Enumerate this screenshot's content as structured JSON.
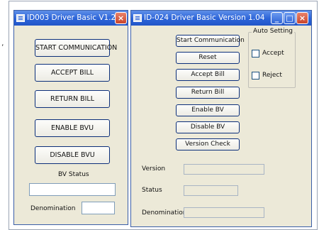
{
  "window1": {
    "title": "ID003 Driver Basic V1.2",
    "close_glyph": "×",
    "buttons": [
      "START COMMUNICATION",
      "ACCEPT BILL",
      "RETURN BILL",
      "ENABLE BVU",
      "DISABLE BVU"
    ],
    "bv_status_label": "BV Status",
    "bv_status_value": "",
    "denomination_label": "Denomination",
    "denomination_value": ""
  },
  "window2": {
    "title": "ID-024 Driver Basic Version 1.04",
    "minimize_glyph": "_",
    "maximize_glyph": "□",
    "close_glyph": "×",
    "buttons": [
      "Start Communication",
      "Reset",
      "Accept Bill",
      "Return Bill",
      "Enable BV",
      "Disable BV",
      "Version Check"
    ],
    "auto_setting": {
      "legend": "Auto Setting",
      "accept_label": "Accept",
      "accept_checked": false,
      "reject_label": "Reject",
      "reject_checked": false
    },
    "version_label": "Version",
    "version_value": "",
    "status_label": "Status",
    "status_value": "",
    "denomination_label": "Denomination",
    "denomination_value": ""
  },
  "icons": [
    "app-icon",
    "close-icon",
    "minimize-icon",
    "maximize-icon"
  ],
  "colors": {
    "titlebar": "#2b63d8",
    "window_bg": "#ece9d8",
    "button_border": "#0c2f7a"
  }
}
